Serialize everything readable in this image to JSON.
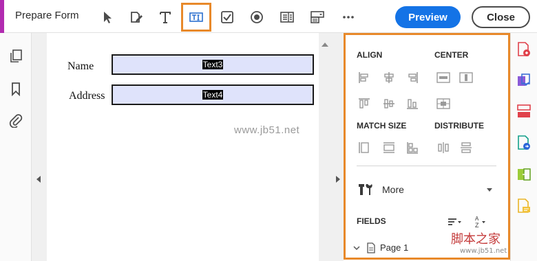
{
  "toolbar": {
    "title": "Prepare Form",
    "preview_label": "Preview",
    "close_label": "Close",
    "tools": [
      {
        "name": "select-tool",
        "icon": "cursor-arrow-icon"
      },
      {
        "name": "sign-tool",
        "icon": "pen-sign-icon"
      },
      {
        "name": "add-text-tool",
        "icon": "text-t-icon"
      },
      {
        "name": "text-field-tool",
        "icon": "text-field-icon",
        "selected": true
      },
      {
        "name": "checkbox-tool",
        "icon": "checkbox-icon"
      },
      {
        "name": "radio-button-tool",
        "icon": "radio-button-icon"
      },
      {
        "name": "list-box-tool",
        "icon": "list-box-icon"
      },
      {
        "name": "dropdown-tool",
        "icon": "dropdown-icon"
      },
      {
        "name": "more-tools",
        "icon": "ellipsis-icon"
      }
    ],
    "accent_color": "#b12bb0",
    "highlight_color": "#e8892a",
    "preview_color": "#1473e6"
  },
  "left_rail": {
    "icons": [
      "pages-icon",
      "bookmark-icon",
      "attachment-icon"
    ]
  },
  "document": {
    "fields": [
      {
        "label": "Name",
        "field_name": "Text3"
      },
      {
        "label": "Address",
        "field_name": "Text4"
      }
    ],
    "watermark": "www.jb51.net",
    "field_fill": "#dfe3fb"
  },
  "panel": {
    "align_title": "ALIGN",
    "center_title": "CENTER",
    "match_size_title": "MATCH SIZE",
    "distribute_title": "DISTRIBUTE",
    "more_label": "More",
    "fields_title": "FIELDS",
    "page_label": "Page 1"
  },
  "tools_rail": {
    "icons": [
      "export-pdf-icon",
      "organize-pages-icon",
      "edit-pdf-icon",
      "create-pdf-icon",
      "compare-icon",
      "comment-icon"
    ]
  },
  "site_watermark": {
    "text": "脚本之家",
    "sub": "www.jb51.net"
  }
}
